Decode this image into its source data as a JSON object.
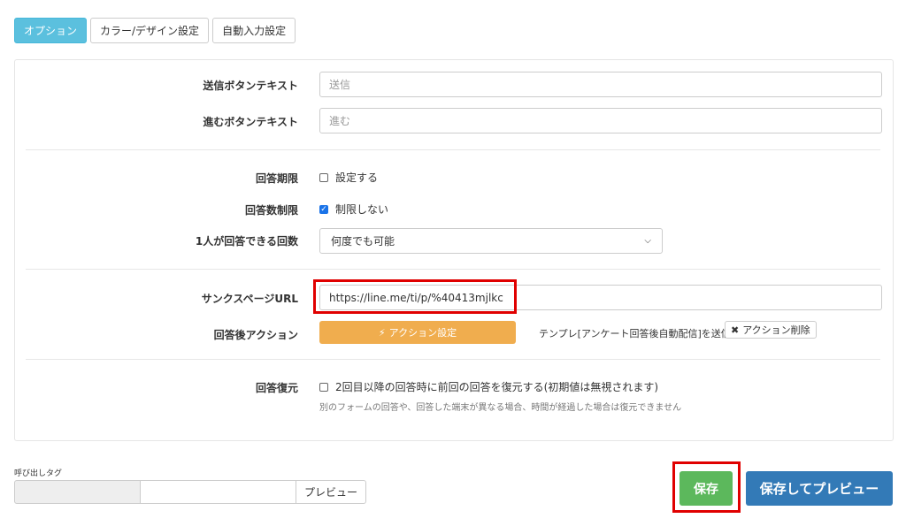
{
  "tabs": [
    {
      "label": "オプション",
      "active": true
    },
    {
      "label": "カラー/デザイン設定",
      "active": false
    },
    {
      "label": "自動入力設定",
      "active": false
    }
  ],
  "form": {
    "submit_text_label": "送信ボタンテキスト",
    "submit_text_placeholder": "送信",
    "next_text_label": "進むボタンテキスト",
    "next_text_placeholder": "進む",
    "deadline_label": "回答期限",
    "deadline_checkbox": "設定する",
    "limit_label": "回答数制限",
    "limit_checkbox": "制限しない",
    "per_person_label": "1人が回答できる回数",
    "per_person_value": "何度でも可能",
    "thanks_url_label": "サンクスページURL",
    "thanks_url_value": "https://line.me/ti/p/%40413mjlkc",
    "after_action_label": "回答後アクション",
    "action_button": "アクション設定",
    "action_desc": "テンプレ[アンケート回答後自動配信]を送信",
    "action_delete": "アクション削除",
    "restore_label": "回答復元",
    "restore_checkbox": "2回目以降の回答時に前回の回答を復元する(初期値は無視されます)",
    "restore_hint": "別のフォームの回答や、回答した端末が異なる場合、時間が経過した場合は復元できません"
  },
  "footer": {
    "tag_label": "呼び出しタグ",
    "preview_small": "プレビュー",
    "save_button": "保存",
    "save_preview_button": "保存してプレビュー"
  },
  "colors": {
    "tab_active": "#5bc0de",
    "action_button": "#f0ad4e",
    "save_button": "#5cb85c",
    "save_preview_button": "#337ab7",
    "highlight_red": "#e00000"
  }
}
